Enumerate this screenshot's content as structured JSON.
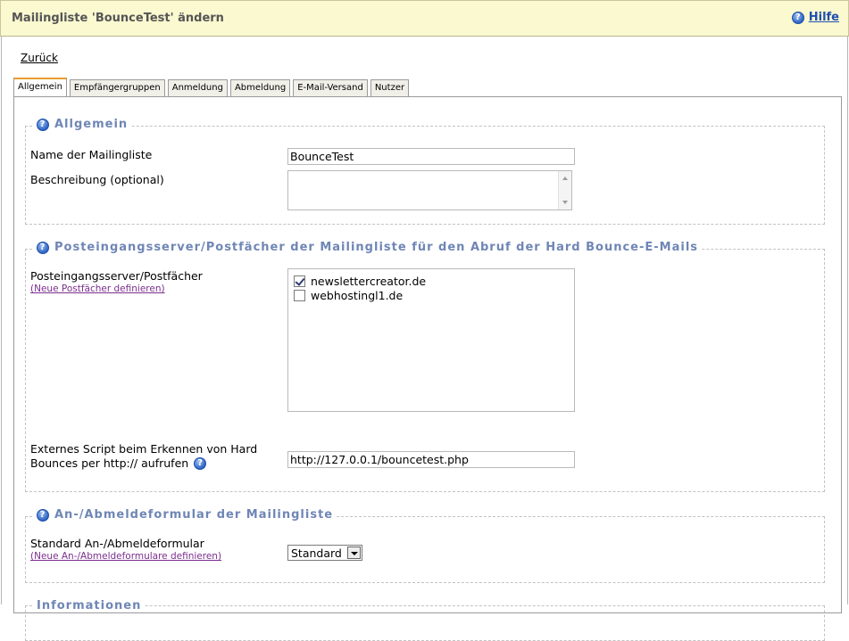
{
  "header": {
    "title": "Mailingliste 'BounceTest' ändern",
    "help_label": "Hilfe",
    "help_icon": "question-icon"
  },
  "nav": {
    "back_label": "Zurück"
  },
  "tabs": [
    {
      "label": "Allgemein",
      "active": true
    },
    {
      "label": "Empfängergruppen"
    },
    {
      "label": "Anmeldung"
    },
    {
      "label": "Abmeldung"
    },
    {
      "label": "E-Mail-Versand"
    },
    {
      "label": "Nutzer"
    }
  ],
  "general": {
    "legend": "Allgemein",
    "name_label": "Name der Mailingliste",
    "name_value": "BounceTest",
    "desc_label": "Beschreibung (optional)",
    "desc_value": ""
  },
  "bounce": {
    "legend": "Posteingangsserver/Postfächer der Mailingliste für den Abruf der Hard Bounce-E-Mails",
    "servers_label": "Posteingangsserver/Postfächer",
    "servers_link": "(Neue Postfächer definieren)",
    "servers": [
      {
        "label": "newslettercreator.de",
        "checked": true
      },
      {
        "label": "webhostingl1.de",
        "checked": false
      }
    ],
    "script_label_line1": "Externes Script beim Erkennen von Hard",
    "script_label_line2": "Bounces per http:// aufrufen",
    "script_value": "http://127.0.0.1/bouncetest.php"
  },
  "forms": {
    "legend": "An-/Abmeldeformular der Mailingliste",
    "form_label": "Standard An-/Abmeldeformular",
    "form_link": "(Neue An-/Abmeldeformulare definieren)",
    "form_selected": "Standard"
  },
  "info": {
    "legend": "Informationen"
  }
}
